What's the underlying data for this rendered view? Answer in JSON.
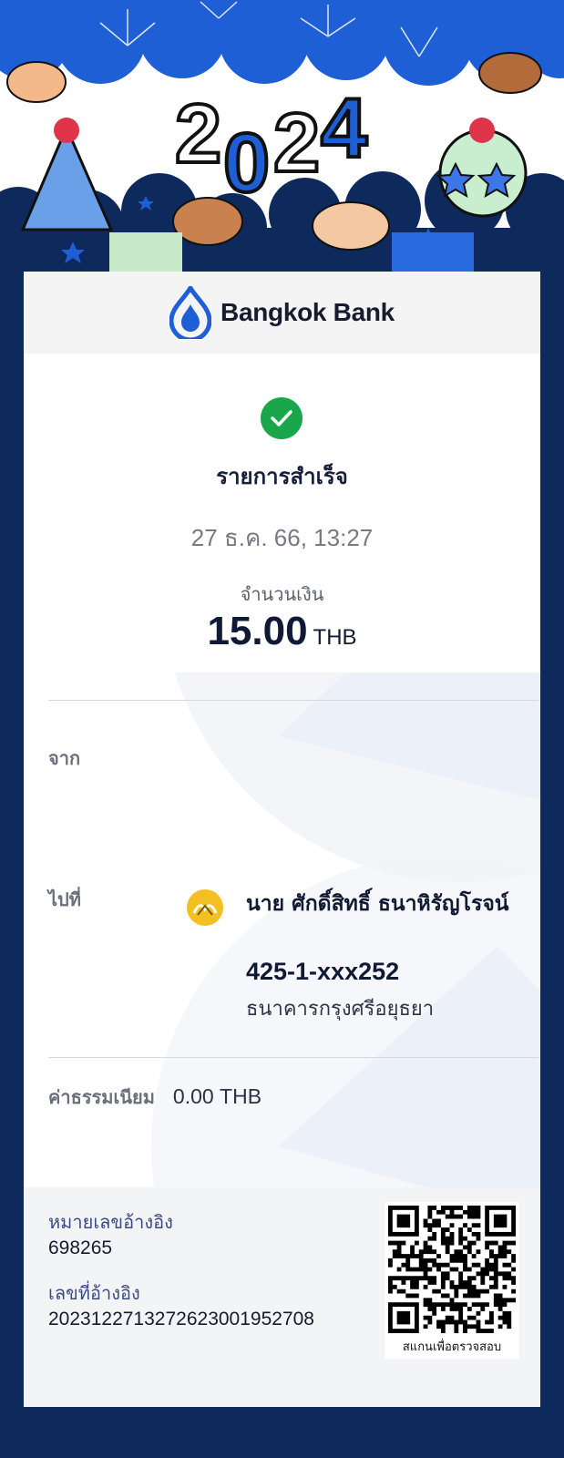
{
  "banner": {
    "year": "2024"
  },
  "header": {
    "bank_name": "Bangkok Bank"
  },
  "status": {
    "title": "รายการสำเร็จ",
    "datetime": "27 ธ.ค. 66, 13:27"
  },
  "amount": {
    "label": "จำนวนเงิน",
    "value": "15.00",
    "currency": "THB"
  },
  "from": {
    "label": "จาก"
  },
  "to": {
    "label": "ไปที่",
    "name": "นาย ศักดิ์สิทธิ์ ธนาหิรัญโรจน์",
    "account": "425-1-xxx252",
    "bank": "ธนาคารกรุงศรีอยุธยา"
  },
  "fee": {
    "label": "ค่าธรรมเนียม",
    "value": "0.00 THB"
  },
  "reference": {
    "ref1_label": "หมายเลขอ้างอิง",
    "ref1_value": "698265",
    "ref2_label": "เลขที่อ้างอิง",
    "ref2_value": "20231227132726230019527​08",
    "qr_caption": "สแกนเพื่อตรวจสอบ"
  },
  "colors": {
    "navy": "#0e2a5c",
    "brand_blue": "#1f5fd6",
    "success_green": "#1aa64a",
    "krungsri_yellow": "#f4c021"
  }
}
